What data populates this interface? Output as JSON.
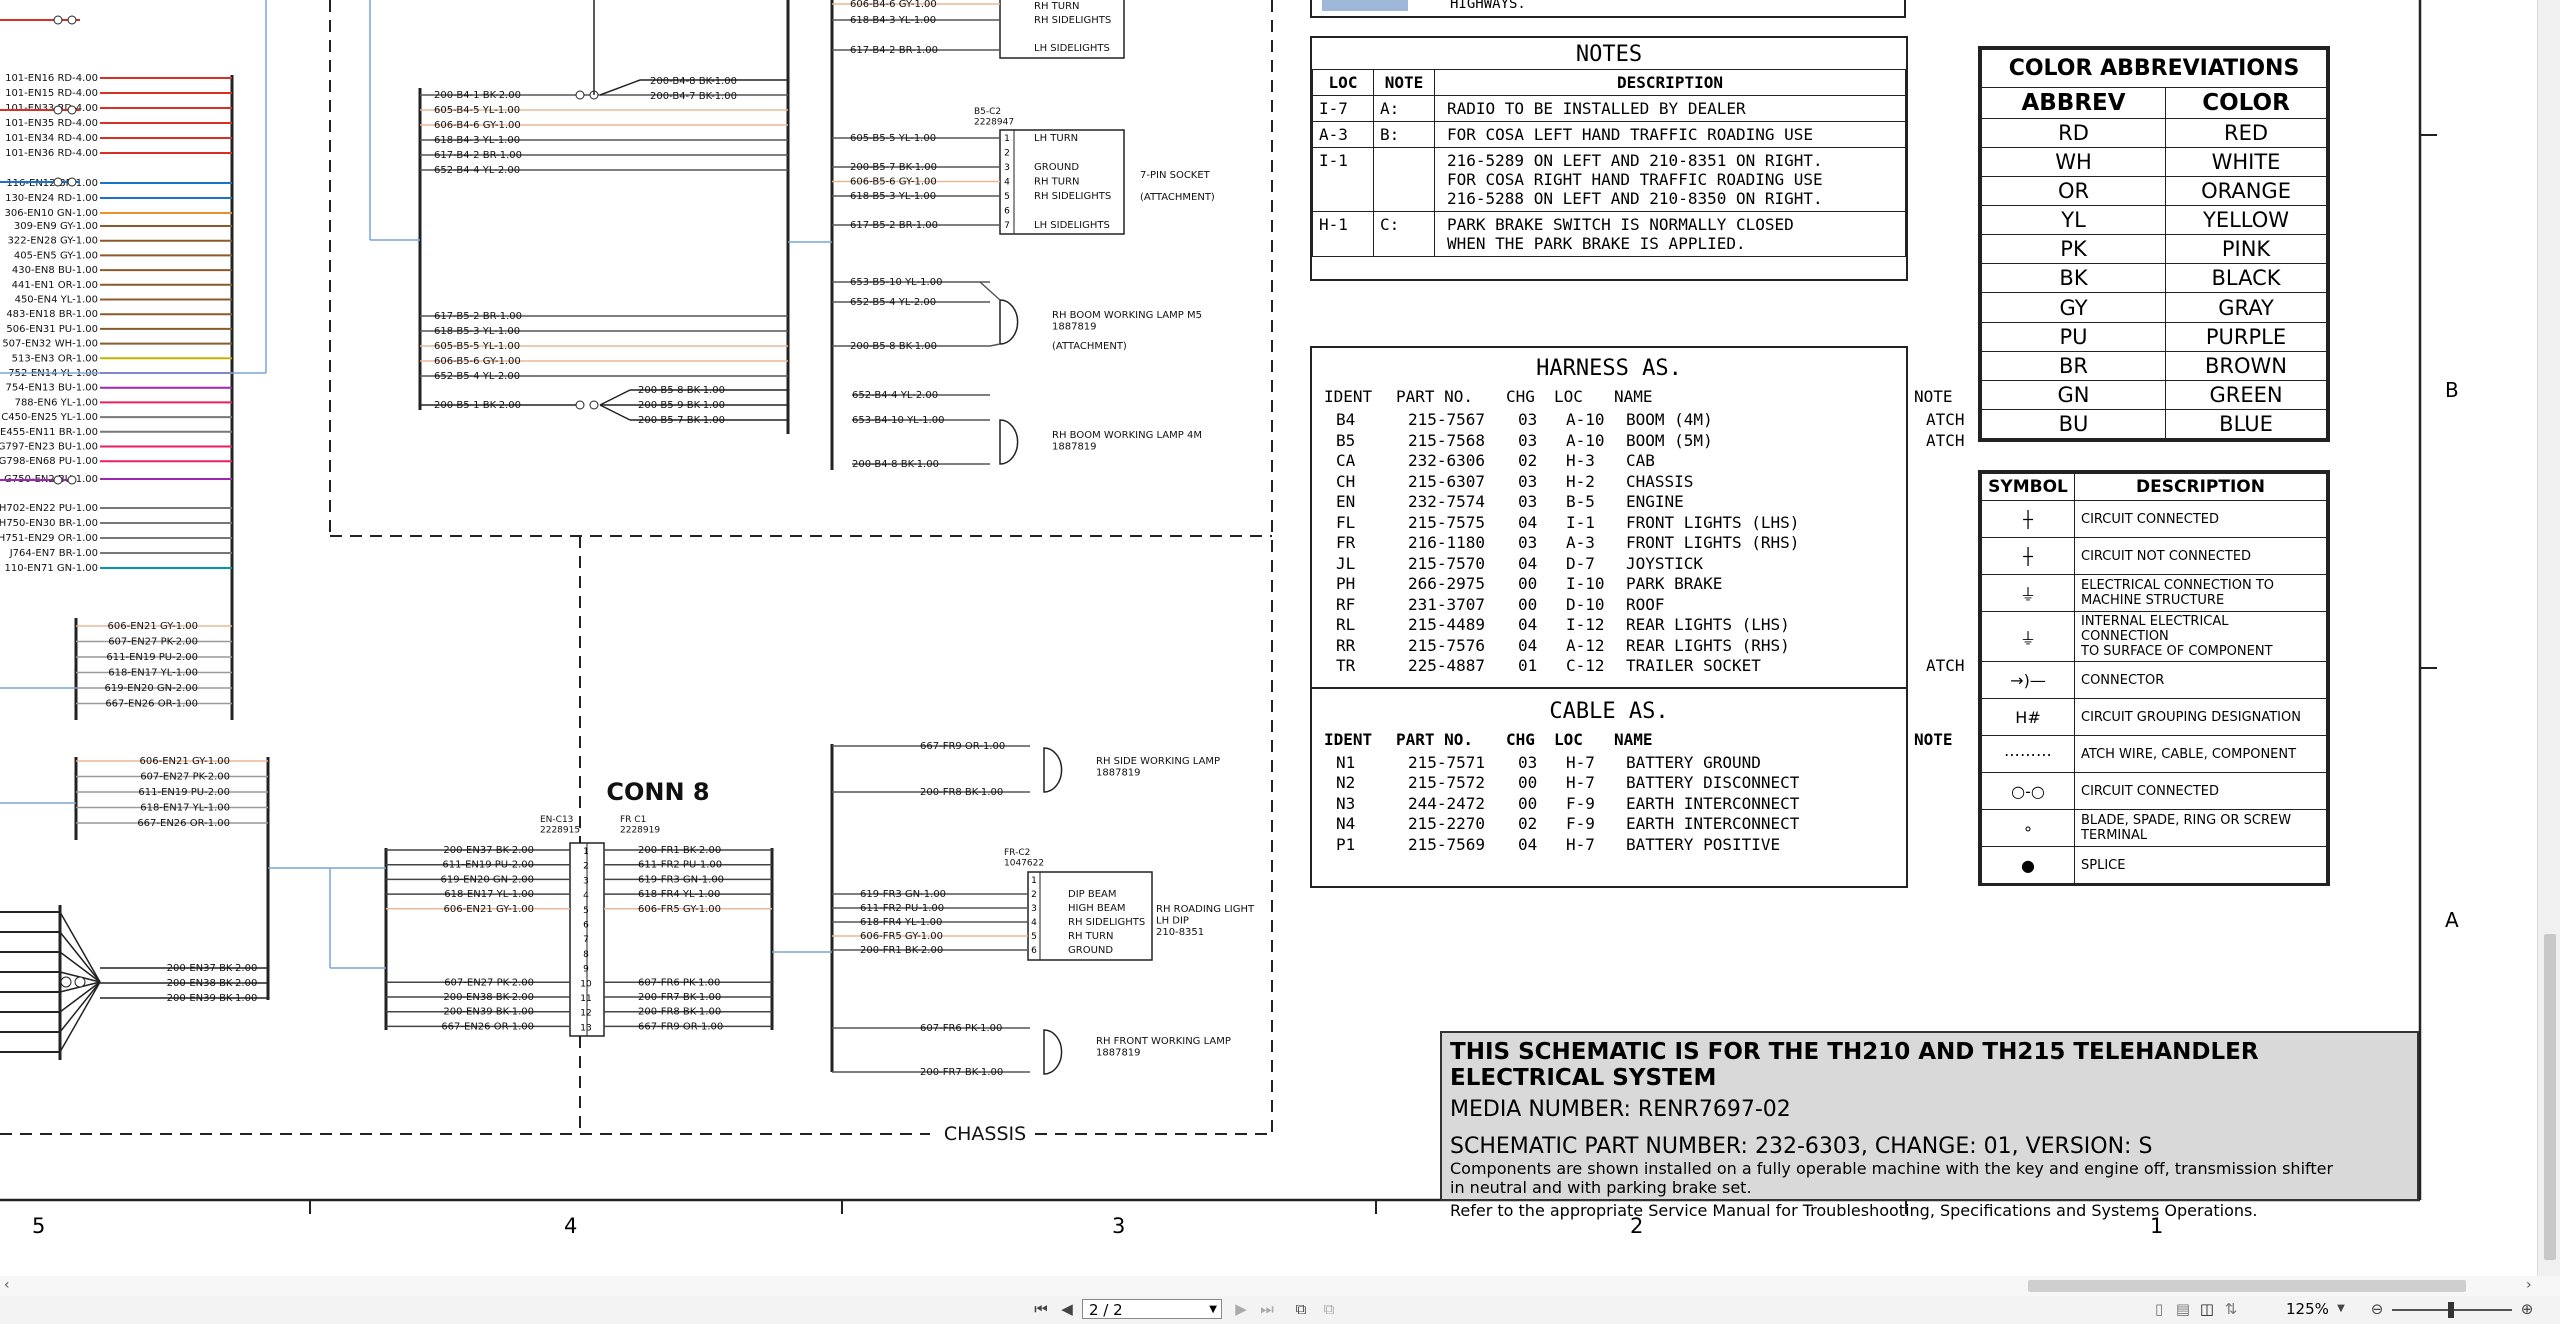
{
  "notes": {
    "title": "NOTES",
    "headers": [
      "LOC",
      "NOTE",
      "DESCRIPTION"
    ],
    "rows": [
      {
        "loc": "I-7",
        "note": "A:",
        "desc": "RADIO TO BE INSTALLED BY DEALER"
      },
      {
        "loc": "A-3",
        "note": "B:",
        "desc": "FOR COSA LEFT HAND TRAFFIC ROADING USE"
      },
      {
        "loc": "I-1",
        "note": "",
        "desc": "216-5289 ON LEFT AND 210-8351 ON RIGHT.\nFOR COSA RIGHT HAND TRAFFIC ROADING USE\n216-5288 ON LEFT AND 210-8350 ON RIGHT."
      },
      {
        "loc": "H-1",
        "note": "C:",
        "desc": "PARK BRAKE SWITCH IS NORMALLY CLOSED\nWHEN THE PARK BRAKE IS APPLIED."
      }
    ],
    "top_fragment": "HIGHWAYS."
  },
  "harness": {
    "title": "HARNESS AS.",
    "headers": [
      "IDENT",
      "PART NO.",
      "CHG",
      "LOC",
      "NAME",
      "NOTE"
    ],
    "rows": [
      [
        "B4",
        "215-7567",
        "03",
        "A-10",
        "BOOM (4M)",
        "ATCH"
      ],
      [
        "B5",
        "215-7568",
        "03",
        "A-10",
        "BOOM (5M)",
        "ATCH"
      ],
      [
        "CA",
        "232-6306",
        "02",
        "H-3",
        "CAB",
        ""
      ],
      [
        "CH",
        "215-6307",
        "03",
        "H-2",
        "CHASSIS",
        ""
      ],
      [
        "EN",
        "232-7574",
        "03",
        "B-5",
        "ENGINE",
        ""
      ],
      [
        "FL",
        "215-7575",
        "04",
        "I-1",
        "FRONT LIGHTS (LHS)",
        ""
      ],
      [
        "FR",
        "216-1180",
        "03",
        "A-3",
        "FRONT LIGHTS (RHS)",
        ""
      ],
      [
        "JL",
        "215-7570",
        "04",
        "D-7",
        "JOYSTICK",
        ""
      ],
      [
        "PH",
        "266-2975",
        "00",
        "I-10",
        "PARK BRAKE",
        ""
      ],
      [
        "RF",
        "231-3707",
        "00",
        "D-10",
        "ROOF",
        ""
      ],
      [
        "RL",
        "215-4489",
        "04",
        "I-12",
        "REAR LIGHTS (LHS)",
        ""
      ],
      [
        "RR",
        "215-7576",
        "04",
        "A-12",
        "REAR LIGHTS (RHS)",
        ""
      ],
      [
        "TR",
        "225-4887",
        "01",
        "C-12",
        "TRAILER SOCKET",
        "ATCH"
      ]
    ]
  },
  "cable": {
    "title": "CABLE AS.",
    "headers": [
      "IDENT",
      "PART NO.",
      "CHG",
      "LOC",
      "NAME",
      "NOTE"
    ],
    "rows": [
      [
        "N1",
        "215-7571",
        "03",
        "H-7",
        "BATTERY GROUND",
        ""
      ],
      [
        "N2",
        "215-7572",
        "00",
        "H-7",
        "BATTERY DISCONNECT",
        ""
      ],
      [
        "N3",
        "244-2472",
        "00",
        "F-9",
        "EARTH INTERCONNECT",
        ""
      ],
      [
        "N4",
        "215-2270",
        "02",
        "F-9",
        "EARTH INTERCONNECT",
        ""
      ],
      [
        "P1",
        "215-7569",
        "04",
        "H-7",
        "BATTERY POSITIVE",
        ""
      ]
    ]
  },
  "colors": {
    "title": "COLOR ABBREVIATIONS",
    "headers": [
      "ABBREV",
      "COLOR"
    ],
    "rows": [
      [
        "RD",
        "RED"
      ],
      [
        "WH",
        "WHITE"
      ],
      [
        "OR",
        "ORANGE"
      ],
      [
        "YL",
        "YELLOW"
      ],
      [
        "PK",
        "PINK"
      ],
      [
        "BK",
        "BLACK"
      ],
      [
        "GY",
        "GRAY"
      ],
      [
        "PU",
        "PURPLE"
      ],
      [
        "BR",
        "BROWN"
      ],
      [
        "GN",
        "GREEN"
      ],
      [
        "BU",
        "BLUE"
      ]
    ]
  },
  "symbols": {
    "headers": [
      "SYMBOL",
      "DESCRIPTION"
    ],
    "rows": [
      {
        "icon": "circuit-connected-icon",
        "glyph": "┼",
        "desc": "CIRCUIT CONNECTED"
      },
      {
        "icon": "circuit-not-connected-icon",
        "glyph": "┼",
        "desc": "CIRCUIT NOT CONNECTED"
      },
      {
        "icon": "machine-ground-icon",
        "glyph": "⏚",
        "desc": "ELECTRICAL CONNECTION TO\nMACHINE STRUCTURE"
      },
      {
        "icon": "component-ground-icon",
        "glyph": "⏚",
        "desc": "INTERNAL ELECTRICAL CONNECTION\nTO SURFACE OF COMPONENT"
      },
      {
        "icon": "connector-icon",
        "glyph": "→)—",
        "desc": "CONNECTOR"
      },
      {
        "icon": "circuit-group-icon",
        "glyph": "H#",
        "desc": "CIRCUIT GROUPING DESIGNATION"
      },
      {
        "icon": "atch-wire-icon",
        "glyph": "⋯⋯⋯",
        "desc": "ATCH WIRE, CABLE, COMPONENT"
      },
      {
        "icon": "circuit-connected-open-icon",
        "glyph": "○-○",
        "desc": "CIRCUIT CONNECTED"
      },
      {
        "icon": "terminal-icon",
        "glyph": "∘",
        "desc": "BLADE, SPADE, RING OR SCREW\nTERMINAL"
      },
      {
        "icon": "splice-icon",
        "glyph": "●",
        "desc": "SPLICE"
      }
    ]
  },
  "titleblock": {
    "line1": "THIS SCHEMATIC IS FOR THE TH210 AND TH215 TELEHANDLER ELECTRICAL SYSTEM",
    "line2": "MEDIA NUMBER: RENR7697-02",
    "line3": "SCHEMATIC PART NUMBER: 232-6303, CHANGE: 01, VERSION: S",
    "line4": "Components are shown installed on a fully operable machine with the key and engine off, transmission shifter",
    "line5": "in neutral and with parking brake set.",
    "line6": "Refer to the appropriate Service Manual for Troubleshooting, Specifications and Systems Operations."
  },
  "zones": {
    "numbers": [
      "5",
      "4",
      "3",
      "2",
      "1"
    ],
    "letters": [
      "B",
      "A"
    ]
  },
  "schematic": {
    "conn8_label": "CONN 8",
    "chassis_label": "CHASSIS",
    "conn8_left": "EN-C13\n2228915",
    "conn8_right": "FR C1\n2228919",
    "b5c2": "B5-C2\n2228947",
    "frc2": "FR-C2\n1047622",
    "socket_label": "7-PIN SOCKET",
    "attachment": "(ATTACHMENT)",
    "rh_boom_5m": "RH BOOM WORKING LAMP M5\n1887819",
    "rh_boom_4m": "RH BOOM WORKING LAMP 4M\n1887819",
    "rh_side": "RH SIDE WORKING LAMP\n1887819",
    "rh_front": "RH FRONT WORKING LAMP\n1887819",
    "rh_roading": "RH ROADING LIGHT\nLH DIP\n210-8351",
    "socket_pins": [
      "LH TURN",
      "",
      "GROUND",
      "RH TURN",
      "RH SIDELIGHTS",
      "",
      "LH SIDELIGHTS"
    ],
    "socket_pins_top": [
      "RH TURN",
      "RH SIDELIGHTS",
      "",
      "LH SIDELIGHTS"
    ],
    "frc2_pins": [
      "",
      "DIP BEAM",
      "HIGH BEAM",
      "RH SIDELIGHTS",
      "RH TURN",
      "GROUND"
    ],
    "left_wires": [
      {
        "label": "101-EN16 RD-4.00",
        "color": "#d93025"
      },
      {
        "label": "101-EN15 RD-4.00",
        "color": "#d93025"
      },
      {
        "label": "101-EN33 RD-4.00",
        "color": "#d93025"
      },
      {
        "label": "101-EN35 RD-4.00",
        "color": "#d93025"
      },
      {
        "label": "101-EN34 RD-4.00",
        "color": "#d93025"
      },
      {
        "label": "101-EN36 RD-4.00",
        "color": "#d93025"
      },
      {
        "label": "116-EN12 BR-1.00",
        "color": "#1a73c8"
      },
      {
        "label": "130-EN24 RD-1.00",
        "color": "#1a73c8"
      },
      {
        "label": "306-EN10 GN-1.00",
        "color": "#e8912d"
      },
      {
        "label": "309-EN9 GY-1.00",
        "color": "#8a5a2b"
      },
      {
        "label": "322-EN28 GY-1.00",
        "color": "#8a5a2b"
      },
      {
        "label": "405-EN5 GY-1.00",
        "color": "#8a5a2b"
      },
      {
        "label": "430-EN8 BU-1.00",
        "color": "#8a5a2b"
      },
      {
        "label": "441-EN1 OR-1.00",
        "color": "#8a5a2b"
      },
      {
        "label": "450-EN4 YL-1.00",
        "color": "#8a5a2b"
      },
      {
        "label": "483-EN18 BR-1.00",
        "color": "#8a5a2b"
      },
      {
        "label": "506-EN31 PU-1.00",
        "color": "#8a5a2b"
      },
      {
        "label": "507-EN32 WH-1.00",
        "color": "#8a5a2b"
      },
      {
        "label": "513-EN3 OR-1.00",
        "color": "#c3b300"
      },
      {
        "label": "752-EN14 YL-1.00",
        "color": "#9c27b0"
      },
      {
        "label": "754-EN13 BU-1.00",
        "color": "#9c27b0"
      },
      {
        "label": "788-EN6 YL-1.00",
        "color": "#e91e63"
      },
      {
        "label": "C450-EN25 YL-1.00",
        "color": "#777"
      },
      {
        "label": "E455-EN11 BR-1.00",
        "color": "#777"
      },
      {
        "label": "G797-EN23 BU-1.00",
        "color": "#e91e63"
      },
      {
        "label": "G798-EN68 PU-1.00",
        "color": "#e91e63"
      },
      {
        "label": "G750-EN2 BU-1.00",
        "color": "#9c27b0"
      },
      {
        "label": "H702-EN22 PU-1.00",
        "color": "#777"
      },
      {
        "label": "H750-EN30 BR-1.00",
        "color": "#777"
      },
      {
        "label": "H751-EN29 OR-1.00",
        "color": "#777"
      },
      {
        "label": "J764-EN7 BR-1.00",
        "color": "#777"
      },
      {
        "label": "110-EN71 GN-1.00",
        "color": "#0097a7"
      }
    ],
    "group_en_1": [
      "606-EN21 GY-1.00",
      "607-EN27 PK-2.00",
      "611-EN19 PU-2.00",
      "618-EN17 YL-1.00",
      "619-EN20 GN-2.00",
      "667-EN26 OR-1.00"
    ],
    "group_en_2": [
      "606-EN21 GY-1.00",
      "607-EN27 PK-2.00",
      "611-EN19 PU-2.00",
      "618-EN17 YL-1.00",
      "667-EN26 OR-1.00"
    ],
    "ground_group": [
      "200-EN37 BK-2.00",
      "200-EN38 BK-2.00",
      "200-EN39 BK-1.00"
    ],
    "conn8_left_wires": [
      "200-EN37 BK-2.00",
      "611-EN19 PU-2.00",
      "619-EN20 GN-2.00",
      "618-EN17 YL-1.00",
      "606-EN21 GY-1.00",
      "",
      "",
      "",
      "",
      "607-EN27 PK-2.00",
      "200-EN38 BK-2.00",
      "200-EN39 BK-1.00",
      "667-EN26 OR-1.00"
    ],
    "conn8_right_wires": [
      "200-FR1 BK-2.00",
      "611-FR2 PU-1.00",
      "619-FR3 GN-1.00",
      "618-FR4 YL-1.00",
      "606-FR5 GY-1.00",
      "",
      "",
      "",
      "",
      "607-FR6 PK-1.00",
      "200-FR7 BK-1.00",
      "200-FR8 BK-1.00",
      "667-FR9 OR-1.00"
    ],
    "b4_group": [
      "200-B4-1 BK-2.00",
      "605-B4-5 YL-1.00",
      "606-B4-6 GY-1.00",
      "618-B4-3 YL-1.00",
      "617-B4-2 BR-1.00",
      "652-B4-4 YL-2.00"
    ],
    "b4_split": [
      "200-B4-8 BK-1.00",
      "200-B4-7 BK-1.00"
    ],
    "b5_group": [
      "617-B5-2 BR-1.00",
      "618-B5-3 YL-1.00",
      "605-B5-5 YL-1.00",
      "606-B5-6 GY-1.00",
      "652-B5-4 YL-2.00"
    ],
    "b5_ground": "200-B5-1 BK-2.00",
    "b5_split": [
      "200-B5-8 BK-1.00",
      "200-B5-9 BK-1.00",
      "200-B5-7 BK-1.00"
    ],
    "socket_top_wires": [
      "606-B4-6 GY-1.00",
      "618-B4-3 YL-1.00",
      "617-B4-2 BR-1.00"
    ],
    "socket_wires": [
      "605-B5-5 YL-1.00",
      "",
      "200-B5-7 BK-1.00",
      "606-B5-6 GY-1.00",
      "618-B5-3 YL-1.00",
      "",
      "617-B5-2 BR-1.00"
    ],
    "lamp5m_wires": [
      "653-B5-10 YL-1.00",
      "652-B5-4 YL-2.00",
      "200-B5-8 BK-1.00"
    ],
    "lamp4m_wires": [
      "652-B4-4 YL-2.00",
      "653-B4-10 YL-1.00",
      "200-B4-8 BK-1.00"
    ],
    "side_lamp_wires": [
      "667-FR9 OR-1.00",
      "200-FR8 BK-1.00"
    ],
    "frc2_wires": [
      "619-FR3 GN-1.00",
      "611-FR2 PU-1.00",
      "618-FR4 YL-1.00",
      "606-FR5 GY-1.00",
      "200-FR1 BK-2.00"
    ],
    "front_lamp_wires": [
      "607-FR6 PK-1.00",
      "200-FR7 BK-1.00"
    ]
  },
  "viewer": {
    "page_value": "2 / 2",
    "zoom": "125%"
  }
}
